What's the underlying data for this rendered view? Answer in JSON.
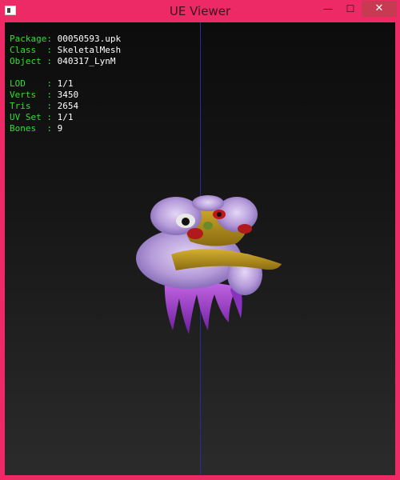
{
  "window": {
    "title": "UE Viewer",
    "minimize_glyph": "—",
    "maximize_glyph": "☐",
    "close_glyph": "✕",
    "frame_color": "#ee2a66",
    "close_color": "#c73a52"
  },
  "info": {
    "package_key": "Package:",
    "package_val": "00050593.upk",
    "class_key": "Class  :",
    "class_val": "SkeletalMesh",
    "object_key": "Object :",
    "object_val": "040317_LynM",
    "lod_key": "LOD    :",
    "lod_val": "1/1",
    "verts_key": "Verts  :",
    "verts_val": "3450",
    "tris_key": "Tris   :",
    "tris_val": "2654",
    "uvset_key": "UV Set :",
    "uvset_val": "1/1",
    "bones_key": "Bones  :",
    "bones_val": "9",
    "key_color": "#33dd33",
    "value_color": "#ffffff"
  },
  "viewport": {
    "axis_color": "#2a2aa0",
    "mesh_icon": "lion-dance-head-mesh"
  }
}
